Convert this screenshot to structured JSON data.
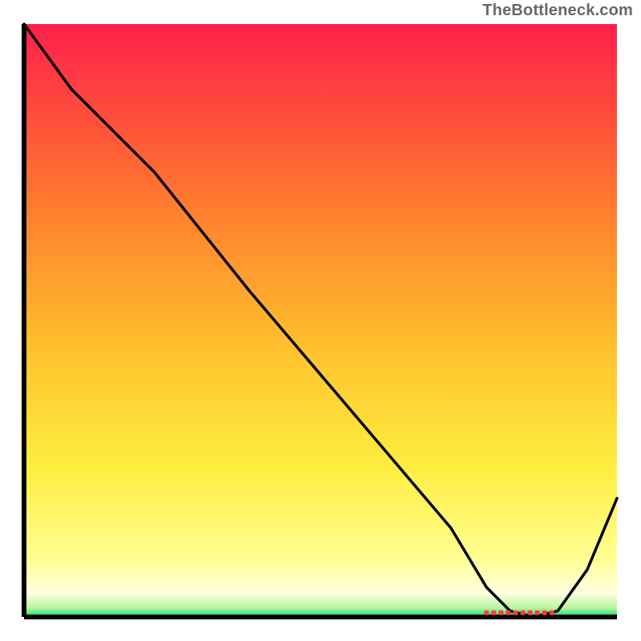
{
  "attribution": "TheBottleneck.com",
  "colors": {
    "gradient_top": "#ff1f4b",
    "gradient_upper_mid": "#ff9a2e",
    "gradient_mid": "#ffd83a",
    "gradient_lower_mid": "#ffff66",
    "gradient_pale": "#ffffd0",
    "gradient_green": "#00e070",
    "axis": "#000000",
    "curve": "#000000",
    "marker": "#ff3a3a"
  },
  "chart_data": {
    "type": "line",
    "title": "",
    "xlabel": "",
    "ylabel": "",
    "xlim": [
      0,
      100
    ],
    "ylim": [
      0,
      100
    ],
    "grid": false,
    "legend": null,
    "series": [
      {
        "name": "bottleneck-curve",
        "x": [
          0,
          8,
          22,
          38,
          55,
          72,
          78,
          82,
          86,
          90,
          95,
          100
        ],
        "values": [
          100,
          89,
          75,
          55,
          35,
          15,
          5,
          1,
          0,
          1,
          8,
          20
        ]
      }
    ],
    "annotations": [
      {
        "name": "optimum-marker",
        "x_start": 78,
        "x_end": 89,
        "y": 0.7
      }
    ]
  }
}
